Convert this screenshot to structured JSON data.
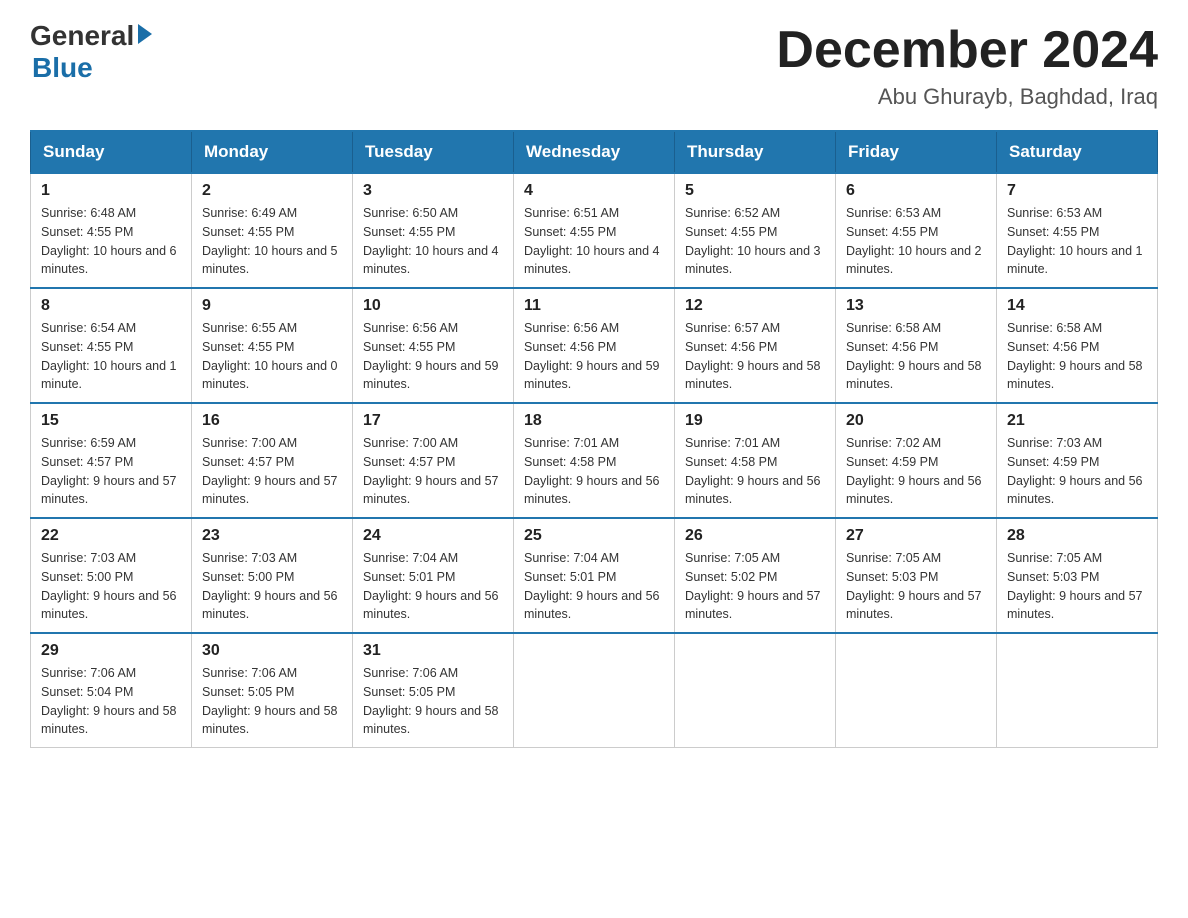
{
  "logo": {
    "general": "General",
    "blue": "Blue"
  },
  "title": "December 2024",
  "subtitle": "Abu Ghurayb, Baghdad, Iraq",
  "days_of_week": [
    "Sunday",
    "Monday",
    "Tuesday",
    "Wednesday",
    "Thursday",
    "Friday",
    "Saturday"
  ],
  "weeks": [
    [
      {
        "day": "1",
        "sunrise": "6:48 AM",
        "sunset": "4:55 PM",
        "daylight": "10 hours and 6 minutes."
      },
      {
        "day": "2",
        "sunrise": "6:49 AM",
        "sunset": "4:55 PM",
        "daylight": "10 hours and 5 minutes."
      },
      {
        "day": "3",
        "sunrise": "6:50 AM",
        "sunset": "4:55 PM",
        "daylight": "10 hours and 4 minutes."
      },
      {
        "day": "4",
        "sunrise": "6:51 AM",
        "sunset": "4:55 PM",
        "daylight": "10 hours and 4 minutes."
      },
      {
        "day": "5",
        "sunrise": "6:52 AM",
        "sunset": "4:55 PM",
        "daylight": "10 hours and 3 minutes."
      },
      {
        "day": "6",
        "sunrise": "6:53 AM",
        "sunset": "4:55 PM",
        "daylight": "10 hours and 2 minutes."
      },
      {
        "day": "7",
        "sunrise": "6:53 AM",
        "sunset": "4:55 PM",
        "daylight": "10 hours and 1 minute."
      }
    ],
    [
      {
        "day": "8",
        "sunrise": "6:54 AM",
        "sunset": "4:55 PM",
        "daylight": "10 hours and 1 minute."
      },
      {
        "day": "9",
        "sunrise": "6:55 AM",
        "sunset": "4:55 PM",
        "daylight": "10 hours and 0 minutes."
      },
      {
        "day": "10",
        "sunrise": "6:56 AM",
        "sunset": "4:55 PM",
        "daylight": "9 hours and 59 minutes."
      },
      {
        "day": "11",
        "sunrise": "6:56 AM",
        "sunset": "4:56 PM",
        "daylight": "9 hours and 59 minutes."
      },
      {
        "day": "12",
        "sunrise": "6:57 AM",
        "sunset": "4:56 PM",
        "daylight": "9 hours and 58 minutes."
      },
      {
        "day": "13",
        "sunrise": "6:58 AM",
        "sunset": "4:56 PM",
        "daylight": "9 hours and 58 minutes."
      },
      {
        "day": "14",
        "sunrise": "6:58 AM",
        "sunset": "4:56 PM",
        "daylight": "9 hours and 58 minutes."
      }
    ],
    [
      {
        "day": "15",
        "sunrise": "6:59 AM",
        "sunset": "4:57 PM",
        "daylight": "9 hours and 57 minutes."
      },
      {
        "day": "16",
        "sunrise": "7:00 AM",
        "sunset": "4:57 PM",
        "daylight": "9 hours and 57 minutes."
      },
      {
        "day": "17",
        "sunrise": "7:00 AM",
        "sunset": "4:57 PM",
        "daylight": "9 hours and 57 minutes."
      },
      {
        "day": "18",
        "sunrise": "7:01 AM",
        "sunset": "4:58 PM",
        "daylight": "9 hours and 56 minutes."
      },
      {
        "day": "19",
        "sunrise": "7:01 AM",
        "sunset": "4:58 PM",
        "daylight": "9 hours and 56 minutes."
      },
      {
        "day": "20",
        "sunrise": "7:02 AM",
        "sunset": "4:59 PM",
        "daylight": "9 hours and 56 minutes."
      },
      {
        "day": "21",
        "sunrise": "7:03 AM",
        "sunset": "4:59 PM",
        "daylight": "9 hours and 56 minutes."
      }
    ],
    [
      {
        "day": "22",
        "sunrise": "7:03 AM",
        "sunset": "5:00 PM",
        "daylight": "9 hours and 56 minutes."
      },
      {
        "day": "23",
        "sunrise": "7:03 AM",
        "sunset": "5:00 PM",
        "daylight": "9 hours and 56 minutes."
      },
      {
        "day": "24",
        "sunrise": "7:04 AM",
        "sunset": "5:01 PM",
        "daylight": "9 hours and 56 minutes."
      },
      {
        "day": "25",
        "sunrise": "7:04 AM",
        "sunset": "5:01 PM",
        "daylight": "9 hours and 56 minutes."
      },
      {
        "day": "26",
        "sunrise": "7:05 AM",
        "sunset": "5:02 PM",
        "daylight": "9 hours and 57 minutes."
      },
      {
        "day": "27",
        "sunrise": "7:05 AM",
        "sunset": "5:03 PM",
        "daylight": "9 hours and 57 minutes."
      },
      {
        "day": "28",
        "sunrise": "7:05 AM",
        "sunset": "5:03 PM",
        "daylight": "9 hours and 57 minutes."
      }
    ],
    [
      {
        "day": "29",
        "sunrise": "7:06 AM",
        "sunset": "5:04 PM",
        "daylight": "9 hours and 58 minutes."
      },
      {
        "day": "30",
        "sunrise": "7:06 AM",
        "sunset": "5:05 PM",
        "daylight": "9 hours and 58 minutes."
      },
      {
        "day": "31",
        "sunrise": "7:06 AM",
        "sunset": "5:05 PM",
        "daylight": "9 hours and 58 minutes."
      },
      null,
      null,
      null,
      null
    ]
  ],
  "labels": {
    "sunrise": "Sunrise:",
    "sunset": "Sunset:",
    "daylight": "Daylight:"
  }
}
